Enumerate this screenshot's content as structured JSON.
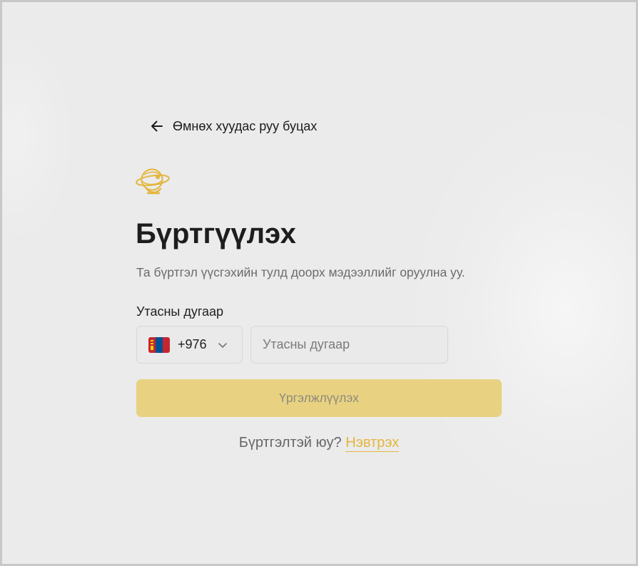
{
  "colors": {
    "accent": "#e4b63d",
    "button_disabled_bg": "#e8d282",
    "background": "#ebebeb"
  },
  "back": {
    "icon": "arrow-left-icon",
    "label": "Өмнөх хуудас руу буцах"
  },
  "logo": {
    "icon": "globe-logo-icon"
  },
  "header": {
    "title": "Бүртгүүлэх",
    "subtitle": "Та бүртгэл үүсгэхийн тулд доорх мэдээллийг оруулна уу."
  },
  "phone": {
    "label": "Утасны дугаар",
    "country_flag_icon": "mongolia-flag-icon",
    "dial_code": "+976",
    "placeholder": "Утасны дугаар",
    "value": ""
  },
  "actions": {
    "continue_label": "Үргэлжлүүлэх"
  },
  "login": {
    "question": "Бүртгэлтэй юу?",
    "link_label": "Нэвтрэх"
  }
}
